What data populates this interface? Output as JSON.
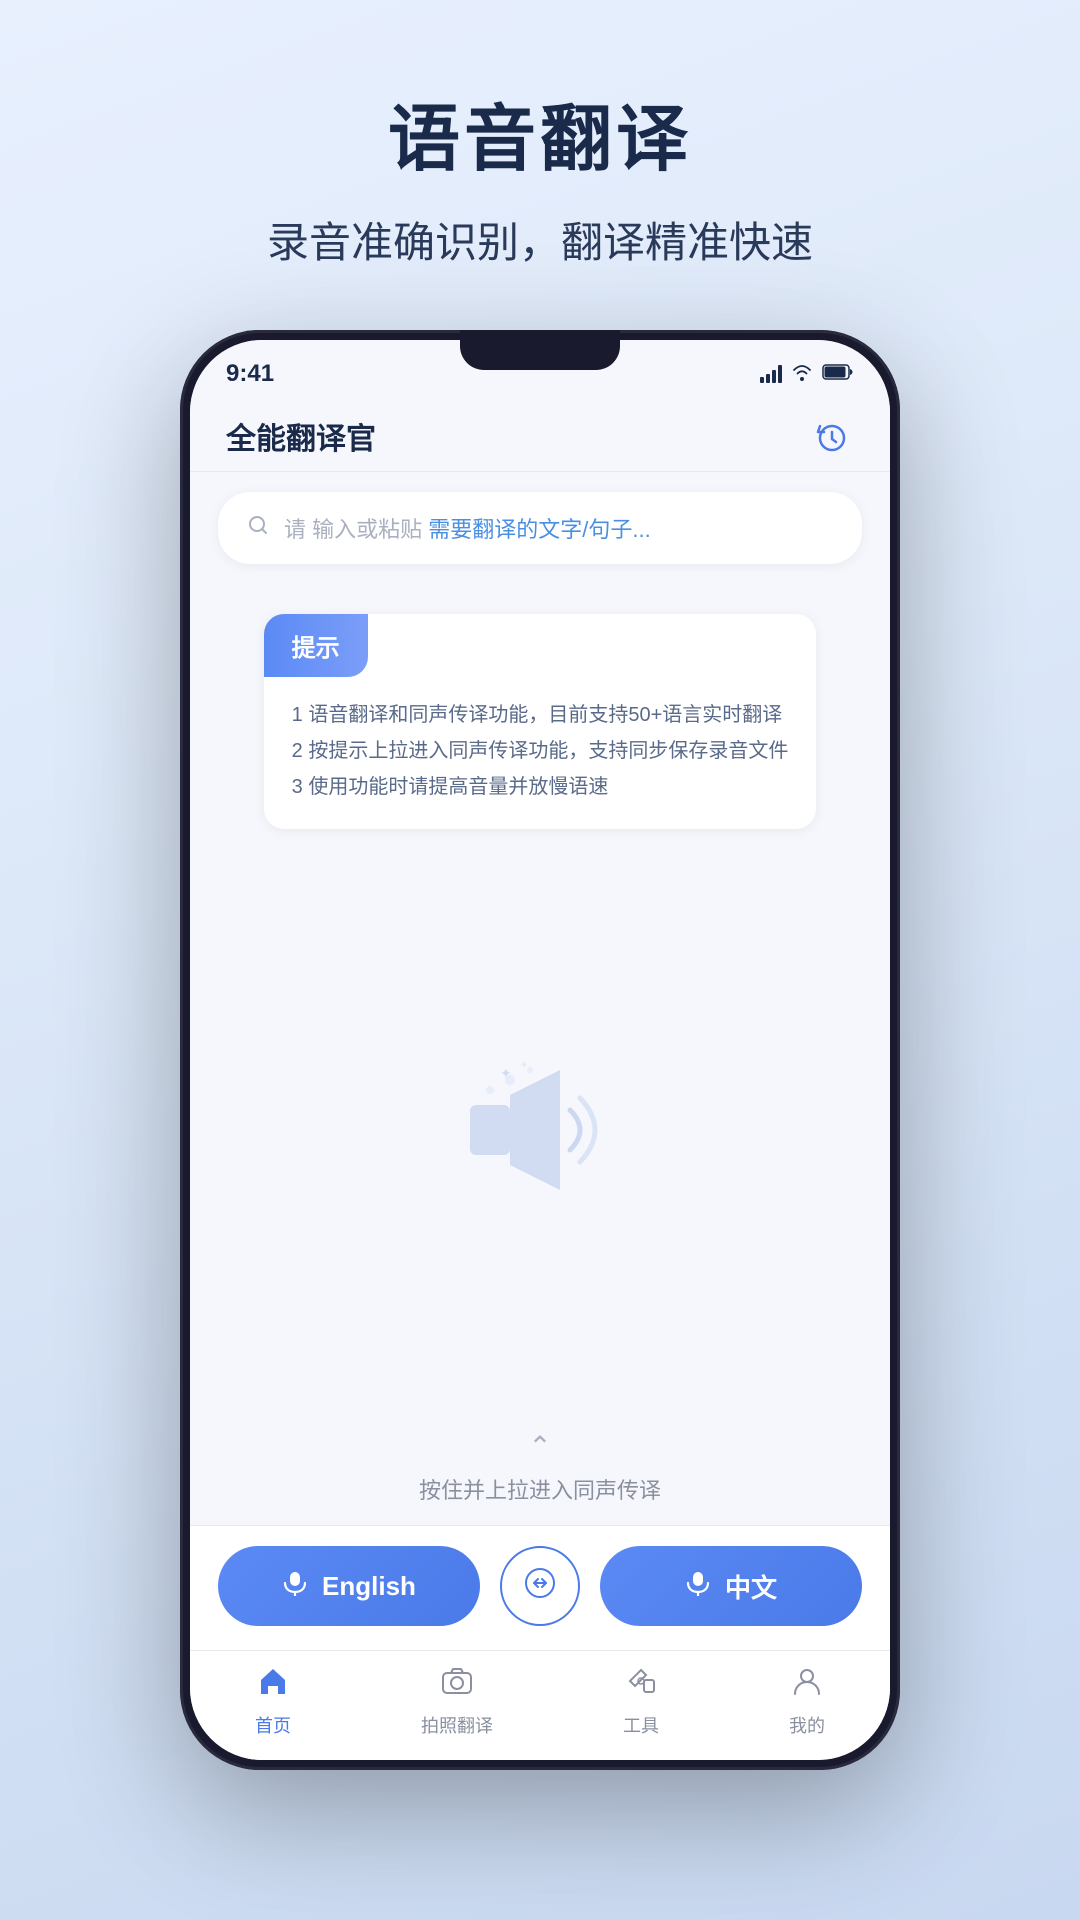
{
  "page": {
    "title": "语音翻译",
    "subtitle": "录音准确识别，翻译精准快速"
  },
  "app": {
    "title": "全能翻译官",
    "history_label": "history"
  },
  "status_bar": {
    "time": "9:41"
  },
  "search": {
    "placeholder_main": "请 输入或粘贴",
    "placeholder_sub": "需要翻译的文字/句子..."
  },
  "tips": {
    "header": "提示",
    "items": [
      "1 语音翻译和同声传译功能，目前支持50+语言实时翻译",
      "2 按提示上拉进入同声传译功能，支持同步保存录音文件",
      "3 使用功能时请提高音量并放慢语速"
    ]
  },
  "drag_hint": {
    "text": "按住并上拉进入同声传译"
  },
  "buttons": {
    "english_label": "English",
    "chinese_label": "中文"
  },
  "nav": {
    "items": [
      {
        "label": "首页",
        "active": true
      },
      {
        "label": "拍照翻译",
        "active": false
      },
      {
        "label": "工具",
        "active": false
      },
      {
        "label": "我的",
        "active": false
      }
    ]
  }
}
